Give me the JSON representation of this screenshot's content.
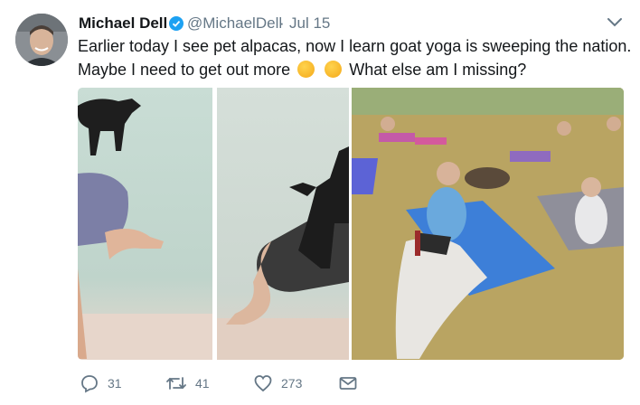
{
  "tweet": {
    "author_name": "Michael Dell",
    "handle": "@MichaelDell",
    "separator": "·",
    "date": "Jul 15",
    "text_line1": "Earlier today I see pet alpacas, now I learn goat yoga is sweeping the nation.",
    "text_line2a": "Maybe I need to get out more",
    "text_line2b": "What else am I missing?",
    "verified": true
  },
  "media": {
    "photos": [
      {
        "description_icon": "photo-goat-on-yoga-leg"
      },
      {
        "description_icon": "photo-goat-on-back"
      },
      {
        "description_icon": "photo-outdoor-goat-yoga-class"
      }
    ]
  },
  "actions": {
    "reply_count": "31",
    "retweet_count": "41",
    "like_count": "273"
  },
  "colors": {
    "text": "#14171a",
    "secondary": "#657786",
    "verified_blue": "#1da1f2"
  }
}
